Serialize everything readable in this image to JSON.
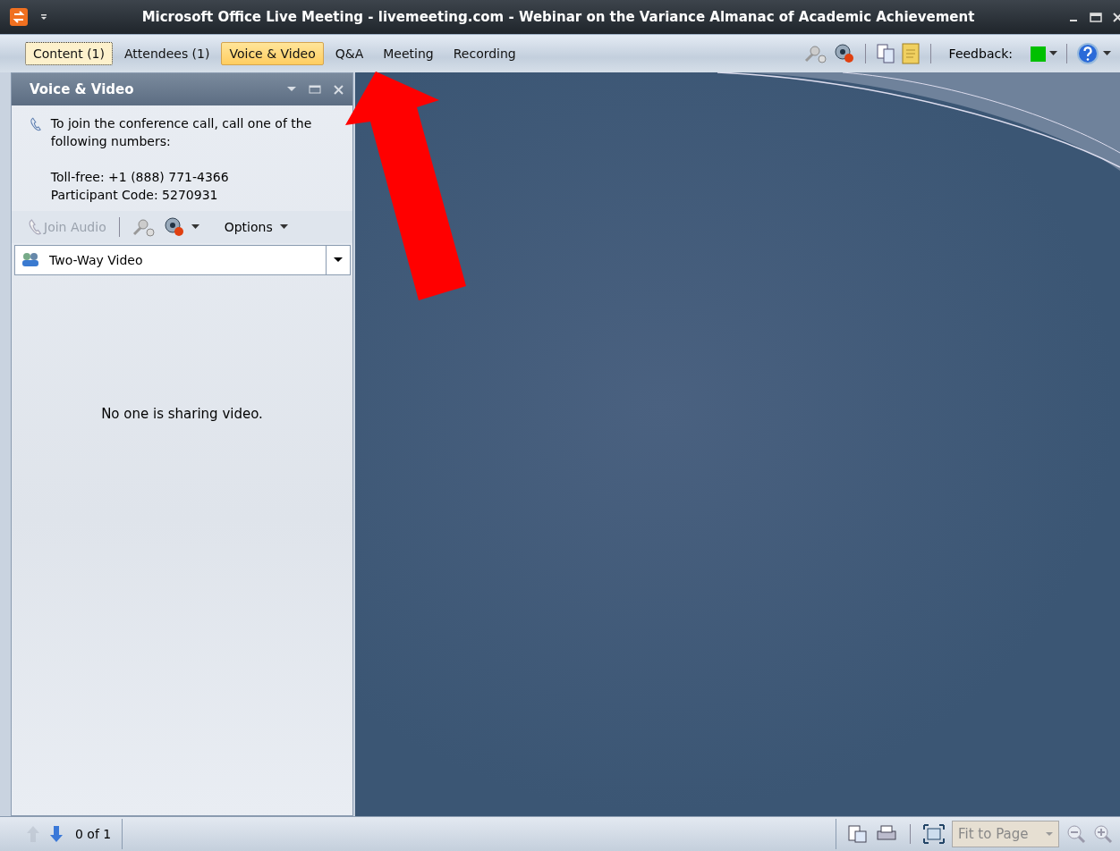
{
  "window": {
    "title": "Microsoft Office Live Meeting - livemeeting.com - Webinar on the Variance Almanac of Academic Achievement"
  },
  "tabs": [
    {
      "label": "Content (1)",
      "selected": false,
      "focused": true
    },
    {
      "label": "Attendees (1)",
      "selected": false,
      "focused": false
    },
    {
      "label": "Voice & Video",
      "selected": true,
      "focused": false
    },
    {
      "label": "Q&A",
      "selected": false,
      "focused": false
    },
    {
      "label": "Meeting",
      "selected": false,
      "focused": false
    },
    {
      "label": "Recording",
      "selected": false,
      "focused": false
    }
  ],
  "feedback": {
    "label": "Feedback:",
    "color": "#00c000"
  },
  "pane": {
    "title": "Voice & Video",
    "instructions": "To join the conference call, call one of the following numbers:",
    "toll_free": "Toll-free: +1 (888) 771-4366",
    "participant_code": "Participant Code: 5270931",
    "join_audio": {
      "label": "Join Audio",
      "disabled": true
    },
    "options": "Options",
    "video_mode": "Two-Way Video",
    "message": "No one is sharing video."
  },
  "status_bar": {
    "prev_disabled": true,
    "page": "0 of 1",
    "zoom": {
      "value": "Fit to Page",
      "disabled": true
    }
  }
}
